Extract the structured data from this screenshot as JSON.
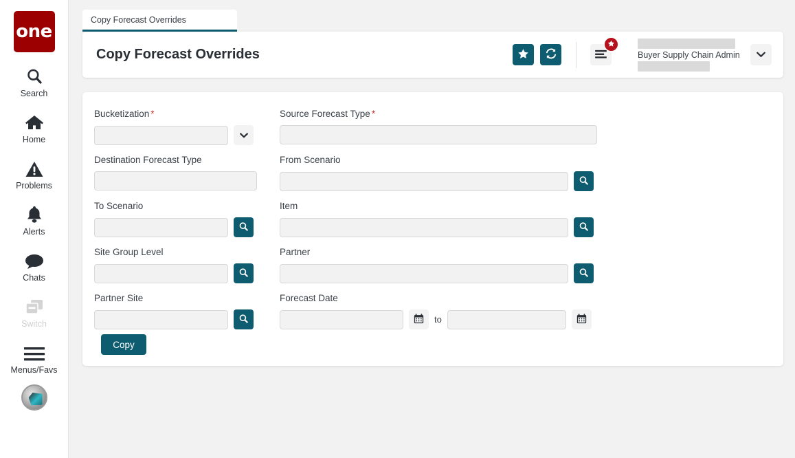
{
  "app": {
    "logo_text": "one",
    "accent_teal": "#0d5c70",
    "brand_red": "#9d0000",
    "badge_red": "#b5121b",
    "required_red": "#d0342c"
  },
  "sidebar": {
    "items": [
      {
        "label": "Search",
        "icon": "search-icon",
        "disabled": false
      },
      {
        "label": "Home",
        "icon": "home-icon",
        "disabled": false
      },
      {
        "label": "Problems",
        "icon": "warning-icon",
        "disabled": false
      },
      {
        "label": "Alerts",
        "icon": "bell-icon",
        "disabled": false
      },
      {
        "label": "Chats",
        "icon": "chat-icon",
        "disabled": false
      },
      {
        "label": "Switch",
        "icon": "switch-icon",
        "disabled": true
      },
      {
        "label": "Menus/Favs",
        "icon": "hamburger-icon",
        "disabled": false
      }
    ],
    "avatar": "user-avatar"
  },
  "tab": {
    "label": "Copy Forecast Overrides"
  },
  "header": {
    "title": "Copy Forecast Overrides",
    "favorite_icon": "star-icon",
    "refresh_icon": "refresh-icon",
    "menu_icon": "hamburger-icon",
    "menu_badge_icon": "star-icon",
    "user_role": "Buyer Supply Chain Admin",
    "caret_icon": "chevron-down-icon"
  },
  "form": {
    "fields": {
      "bucketization": {
        "label": "Bucketization",
        "required": true,
        "value": "",
        "placeholder": ""
      },
      "source_forecast_type": {
        "label": "Source Forecast Type",
        "required": true,
        "value": "",
        "placeholder": ""
      },
      "destination_forecast_type": {
        "label": "Destination Forecast Type",
        "required": false,
        "value": "",
        "placeholder": ""
      },
      "from_scenario": {
        "label": "From Scenario",
        "required": false,
        "value": "",
        "placeholder": ""
      },
      "to_scenario": {
        "label": "To Scenario",
        "required": false,
        "value": "",
        "placeholder": ""
      },
      "item": {
        "label": "Item",
        "required": false,
        "value": "",
        "placeholder": ""
      },
      "site_group_level": {
        "label": "Site Group Level",
        "required": false,
        "value": "",
        "placeholder": ""
      },
      "partner": {
        "label": "Partner",
        "required": false,
        "value": "",
        "placeholder": ""
      },
      "partner_site": {
        "label": "Partner Site",
        "required": false,
        "value": "",
        "placeholder": ""
      },
      "forecast_date": {
        "label": "Forecast Date",
        "required": false,
        "from_value": "",
        "to_value": "",
        "range_separator": "to"
      }
    },
    "submit_label": "Copy"
  }
}
